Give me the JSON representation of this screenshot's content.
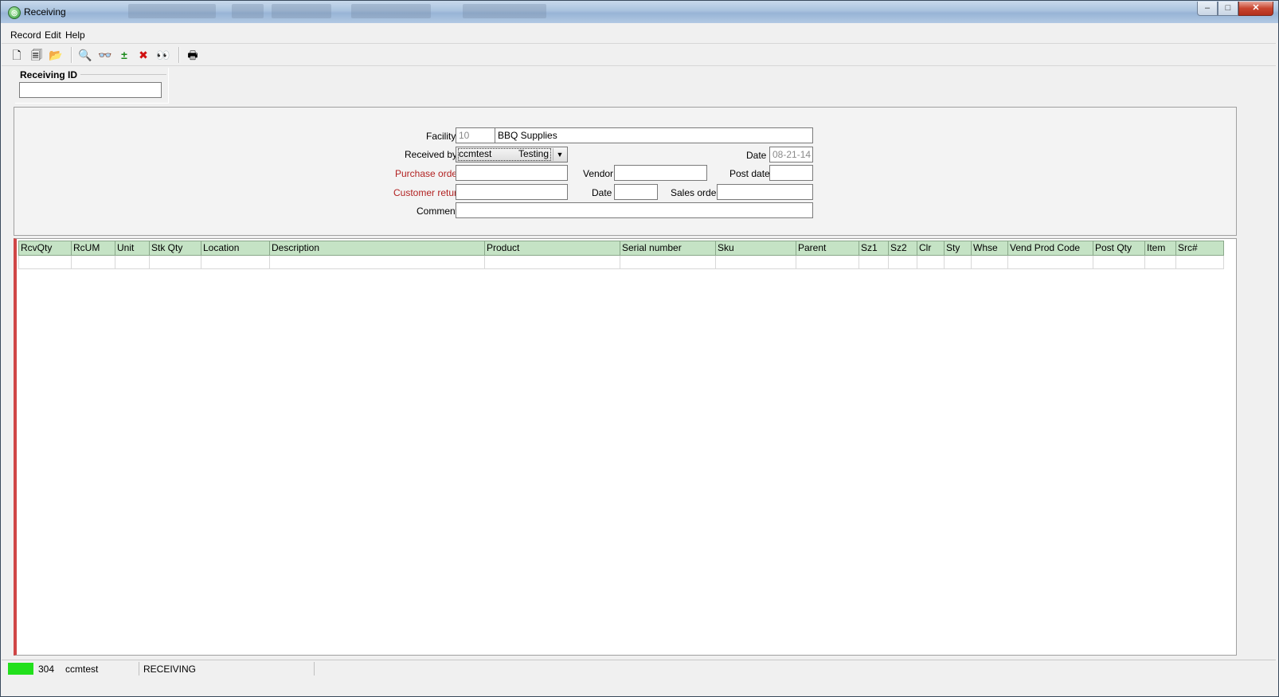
{
  "window": {
    "title": "Receiving",
    "controls": {
      "minimize": "‒",
      "maximize": "□",
      "close": "✕"
    }
  },
  "menu": {
    "items": [
      "Record",
      "Edit",
      "Help"
    ]
  },
  "toolbar": {
    "buttons": [
      {
        "name": "new-record-icon",
        "glyph": "🗋"
      },
      {
        "name": "copy-record-icon",
        "glyph": "🗐"
      },
      {
        "name": "open-folder-icon",
        "glyph": "📂"
      },
      {
        "name": "zoom-icon",
        "glyph": "🔍"
      },
      {
        "name": "glasses-icon",
        "glyph": "👓"
      },
      {
        "name": "add-line-icon",
        "glyph": "±"
      },
      {
        "name": "delete-icon",
        "glyph": "✖"
      },
      {
        "name": "binoculars-icon",
        "glyph": "👀"
      },
      {
        "name": "print-icon",
        "glyph": "🖶"
      }
    ]
  },
  "receiving_id": {
    "label": "Receiving ID",
    "value": ""
  },
  "form": {
    "facility": {
      "label": "Facility",
      "code": "10",
      "name": "BBQ Supplies"
    },
    "received_by": {
      "label": "Received by",
      "user": "ccmtest",
      "name": "Testing"
    },
    "date": {
      "label": "Date",
      "value": "08-21-14"
    },
    "purchase_order": {
      "label": "Purchase order",
      "value": ""
    },
    "vendor": {
      "label": "Vendor",
      "value": ""
    },
    "post_date": {
      "label": "Post date",
      "value": ""
    },
    "customer_return": {
      "label": "Customer return",
      "value": ""
    },
    "return_date": {
      "label": "Date",
      "value": ""
    },
    "sales_order": {
      "label": "Sales order",
      "value": ""
    },
    "comment": {
      "label": "Comment",
      "value": ""
    }
  },
  "grid": {
    "columns": [
      "RcvQty",
      "RcUM",
      "Unit",
      "Stk Qty",
      "Location",
      "Description",
      "Product",
      "Serial number",
      "Sku",
      "Parent",
      "Sz1",
      "Sz2",
      "Clr",
      "Sty",
      "Whse",
      "Vend Prod Code",
      "Post Qty",
      "Item",
      "Src#"
    ],
    "rows": [
      [
        "",
        "",
        "",
        "",
        "",
        "",
        "",
        "",
        "",
        "",
        "",
        "",
        "",
        "",
        "",
        "",
        "",
        "",
        ""
      ]
    ]
  },
  "status": {
    "indicator_color": "#22e01c",
    "code": "304",
    "user": "ccmtest",
    "module": "RECEIVING"
  },
  "colors": {
    "required_label": "#b22222",
    "grid_header": "#c5e3c5"
  }
}
